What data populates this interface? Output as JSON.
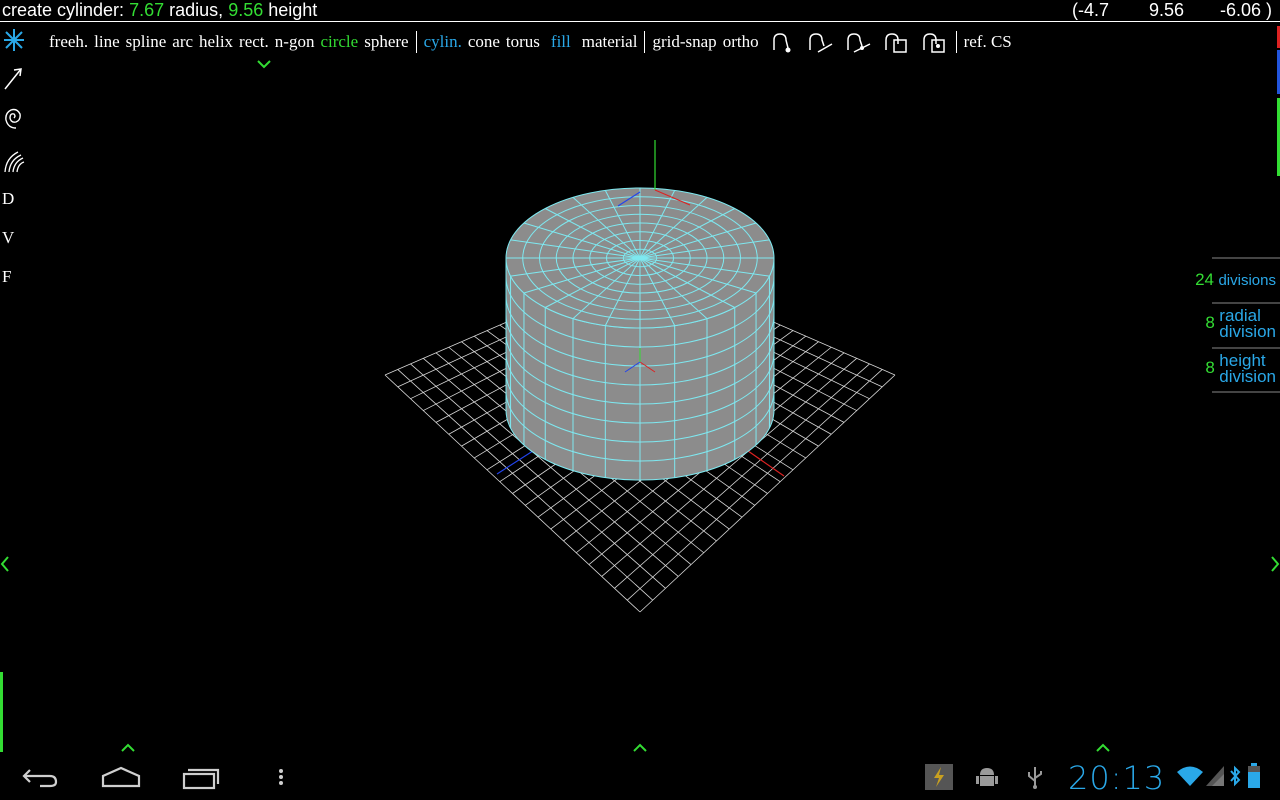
{
  "status": {
    "prefix": "create cylinder:",
    "radius_value": "7.67",
    "radius_label": "radius,",
    "height_value": "9.56",
    "height_label": "height"
  },
  "coordinates": {
    "x": "(-4.7",
    "y": "9.56",
    "z": "-6.06 )"
  },
  "toolbar": {
    "freehand": "freeh.",
    "line": "line",
    "spline": "spline",
    "arc": "arc",
    "helix": "helix",
    "rect": "rect.",
    "ngon": "n-gon",
    "circle": "circle",
    "sphere": "sphere",
    "cylinder": "cylin.",
    "cone": "cone",
    "torus": "torus",
    "fill": "fill",
    "material": "material",
    "grid_snap": "grid-snap",
    "ortho": "ortho",
    "ref_cs": "ref. CS"
  },
  "left_tools": {
    "letters": [
      "D",
      "V",
      "F"
    ]
  },
  "right_panel": {
    "divisions": {
      "value": "24",
      "label": "divisions"
    },
    "radial": {
      "value": "8",
      "label_line1": "radial",
      "label_line2": "division"
    },
    "height": {
      "value": "8",
      "label_line1": "height",
      "label_line2": "division"
    }
  },
  "system_bar": {
    "clock": "20:13"
  },
  "colors": {
    "accent_green": "#33dd33",
    "accent_cyan": "#2aa8e8",
    "mesh_face": "#8a8a8a",
    "mesh_line": "#7ee8f0"
  }
}
